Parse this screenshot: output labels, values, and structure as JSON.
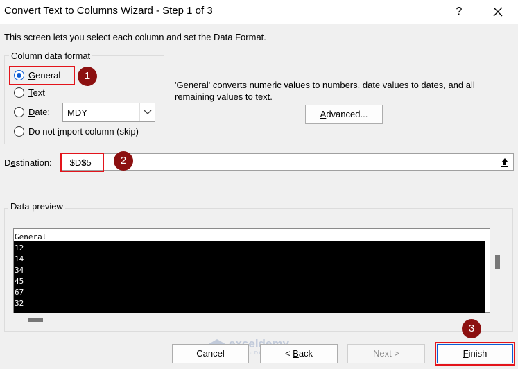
{
  "window": {
    "title": "Convert Text to Columns Wizard - Step 1 of 3",
    "help_glyph": "?"
  },
  "intro_text": "This screen lets you select each column and set the Data Format.",
  "column_format": {
    "group_title": "Column data format",
    "options": [
      {
        "label": "General",
        "underline": "G",
        "rest": "eneral",
        "checked": true
      },
      {
        "label": "Text",
        "underline": "T",
        "rest": "ext",
        "checked": false
      },
      {
        "label": "Date:",
        "underline": "D",
        "rest": "ate:",
        "checked": false
      },
      {
        "label": "Do not import column (skip)",
        "pre": "Do not ",
        "underline": "i",
        "rest": "mport column (skip)",
        "checked": false
      }
    ],
    "date_format_value": "MDY"
  },
  "description": "'General' converts numeric values to numbers, date values to dates, and all remaining values to text.",
  "advanced_button": {
    "underline": "A",
    "rest": "dvanced..."
  },
  "destination": {
    "label_pre": "D",
    "label_u": "e",
    "label_rest": "stination:",
    "value": "=$D$5"
  },
  "data_preview": {
    "group_title": "Data preview",
    "header": "General",
    "rows": [
      "12",
      "14",
      "34",
      "45",
      "67",
      "32"
    ]
  },
  "buttons": {
    "cancel": "Cancel",
    "back_pre": "< ",
    "back_u": "B",
    "back_rest": "ack",
    "next": "Next >",
    "finish_u": "F",
    "finish_rest": "inish"
  },
  "annotations": [
    "1",
    "2",
    "3"
  ],
  "watermark": {
    "name": "exceldemy",
    "sub": "EXCEL · DATA · BI"
  },
  "colors": {
    "highlight": "#e3141b",
    "marker": "#8c1010",
    "radio_accent": "#0b5cd5"
  }
}
